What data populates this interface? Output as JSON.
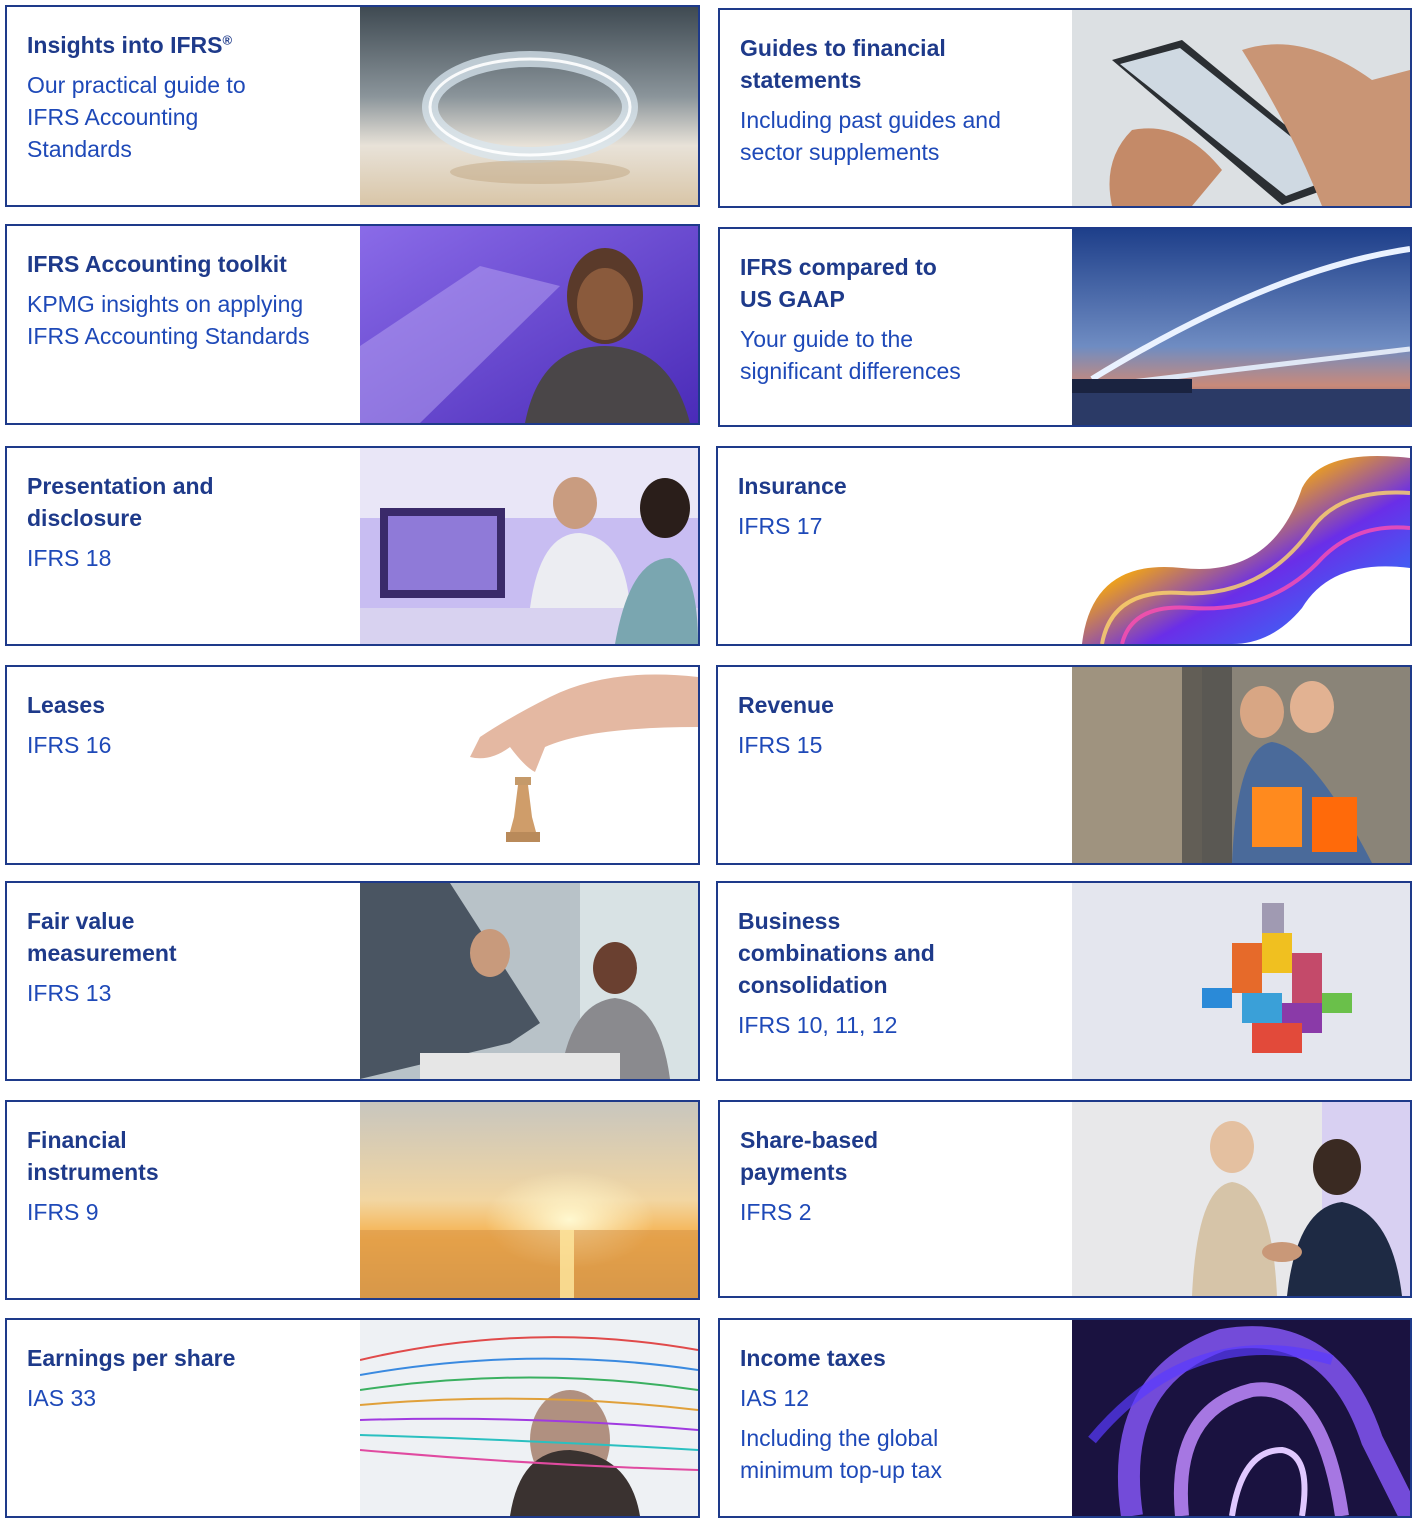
{
  "colors": {
    "accent": "#1e3a8a",
    "subtext": "#1e49b8",
    "border": "#1e3a8a"
  },
  "cards": [
    {
      "title": "Insights into IFRS",
      "title_sup": "®",
      "subtitle": "Our practical guide to IFRS Accounting Standards",
      "image": "glass-ring-photo"
    },
    {
      "title": "Guides to financial statements",
      "subtitle": "Including past guides and sector supplements",
      "image": "hand-tablet-photo"
    },
    {
      "title": "IFRS Accounting toolkit",
      "subtitle": "KPMG insights on applying IFRS Accounting Standards",
      "image": "smiling-woman-photo"
    },
    {
      "title": "IFRS compared to US GAAP",
      "subtitle": "Your guide to the significant differences",
      "image": "bridge-dusk-photo"
    },
    {
      "title": "Presentation and disclosure",
      "subtitle": "IFRS 18",
      "image": "office-meeting-photo"
    },
    {
      "title": "Insurance",
      "subtitle": "IFRS 17",
      "image": "abstract-ribbon-photo"
    },
    {
      "title": "Leases",
      "subtitle": "IFRS 16",
      "image": "hand-chess-piece-photo"
    },
    {
      "title": "Revenue",
      "subtitle": "IFRS 15",
      "image": "shopping-women-photo"
    },
    {
      "title": "Fair value measurement",
      "subtitle": "IFRS 13",
      "image": "handshake-meeting-photo"
    },
    {
      "title": "Business combinations and consolidation",
      "subtitle": "IFRS 10, 11, 12",
      "image": "colored-blocks-photo"
    },
    {
      "title": "Financial instruments",
      "subtitle": "IFRS 9",
      "image": "sea-sunrise-photo"
    },
    {
      "title": "Share-based payments",
      "subtitle": "IFRS 2",
      "image": "handshake-colleagues-photo"
    },
    {
      "title": "Earnings per share",
      "subtitle": "IAS 33",
      "image": "data-lines-woman-photo"
    },
    {
      "title": "Income taxes",
      "subtitle": "IAS 12",
      "subtitle2": "Including the global minimum top-up tax",
      "image": "purple-swirl-photo"
    }
  ]
}
